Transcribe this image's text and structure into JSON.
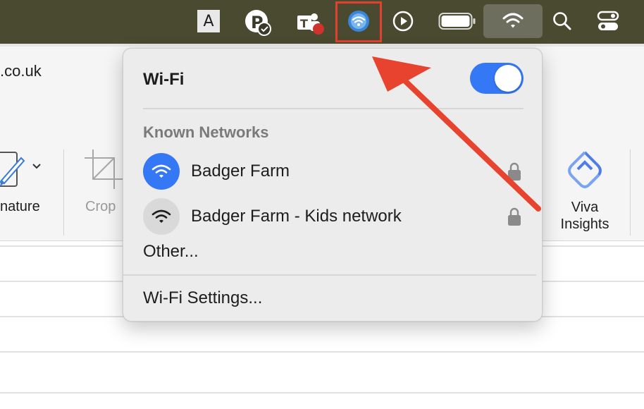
{
  "menubar": {
    "font_icon_letter": "A",
    "icons": [
      "font-menu-icon",
      "p-app-icon",
      "teams-icon",
      "vpn-icon",
      "play-icon",
      "battery-icon",
      "wifi-icon",
      "search-icon",
      "control-center-icon"
    ],
    "highlight_color": "#e24030",
    "background_color": "#4a4a30"
  },
  "app": {
    "url_fragment": ".co.uk",
    "ribbon": {
      "signature_label": "nature",
      "crop_label": "Crop",
      "viva_label_line1": "Viva",
      "viva_label_line2": "Insights"
    }
  },
  "wifi_menu": {
    "title": "Wi-Fi",
    "toggle_on": true,
    "known_networks_heading": "Known Networks",
    "networks": [
      {
        "name": "Badger Farm",
        "connected": true,
        "secured": true
      },
      {
        "name": "Badger Farm - Kids network",
        "connected": false,
        "secured": true
      }
    ],
    "other_label": "Other...",
    "settings_label": "Wi-Fi Settings...",
    "accent_color": "#3478f6"
  },
  "annotation": {
    "arrow_color": "#e8432e"
  }
}
